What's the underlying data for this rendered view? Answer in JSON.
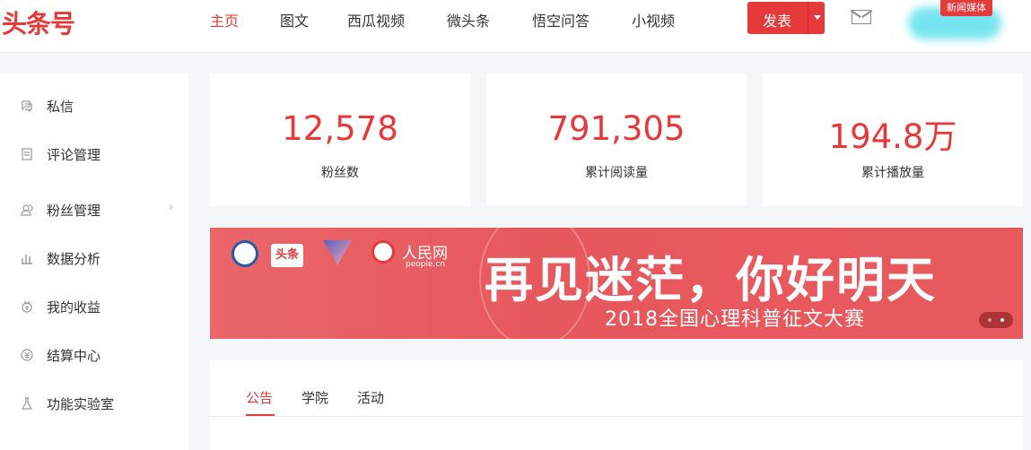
{
  "header": {
    "logo": "头条号",
    "nav": [
      {
        "label": "主页",
        "active": true
      },
      {
        "label": "图文",
        "active": false
      },
      {
        "label": "西瓜视频",
        "active": false
      },
      {
        "label": "微头条",
        "active": false
      },
      {
        "label": "悟空问答",
        "active": false
      },
      {
        "label": "小视频",
        "active": false
      }
    ],
    "publish_label": "发表",
    "user_badge": "新闻媒体",
    "accent_color": "#e5393a"
  },
  "sidebar": {
    "items": [
      {
        "label": "私信",
        "icon": "chat-icon"
      },
      {
        "label": "评论管理",
        "icon": "comment-icon"
      },
      {
        "label": "粉丝管理",
        "icon": "fans-icon",
        "has_submenu": true
      },
      {
        "label": "数据分析",
        "icon": "bar-chart-icon"
      },
      {
        "label": "我的收益",
        "icon": "income-icon"
      },
      {
        "label": "结算中心",
        "icon": "settlement-icon"
      },
      {
        "label": "功能实验室",
        "icon": "flask-icon"
      }
    ]
  },
  "stats": [
    {
      "value": "12,578",
      "label": "粉丝数"
    },
    {
      "value": "791,305",
      "label": "累计阅读量"
    },
    {
      "value": "194.8万",
      "label": "累计播放量"
    }
  ],
  "banner": {
    "partner_tag": "头条",
    "brand": "人民网",
    "brand_sub": "people.cn",
    "headline": "再见迷茫，你好明天",
    "subheadline": "2018全国心理科普征文大赛",
    "slides": 2,
    "active_slide": 2
  },
  "panel": {
    "tabs": [
      {
        "label": "公告",
        "active": true
      },
      {
        "label": "学院",
        "active": false
      },
      {
        "label": "活动",
        "active": false
      }
    ]
  }
}
